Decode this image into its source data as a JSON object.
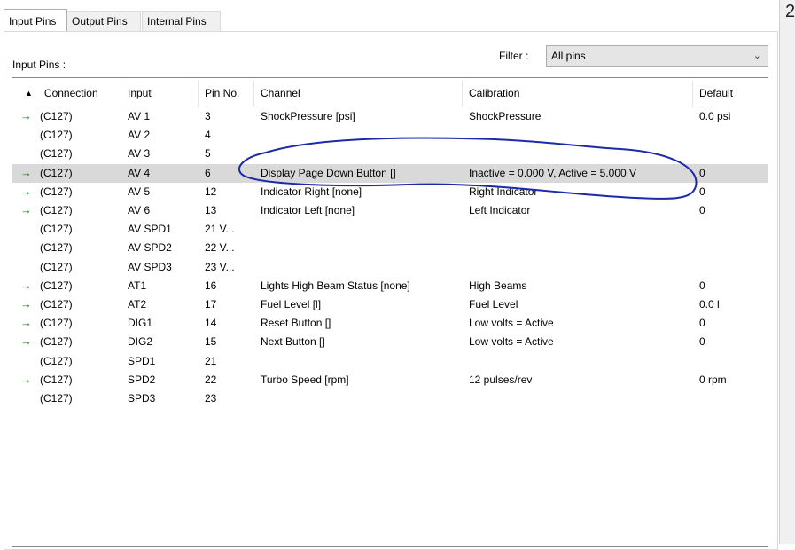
{
  "tabs": [
    {
      "label": "Input Pins",
      "active": true
    },
    {
      "label": "Output Pins",
      "active": false
    },
    {
      "label": "Internal Pins",
      "active": false
    }
  ],
  "panel": {
    "section_label": "Input Pins :",
    "filter_label": "Filter :",
    "filter_value": "All pins"
  },
  "table": {
    "columns": [
      "Connection",
      "Input",
      "Pin No.",
      "Channel",
      "Calibration",
      "Default"
    ],
    "rows": [
      {
        "arrow": true,
        "connection": "(C127)",
        "input": "AV 1",
        "pin": "3",
        "channel": "ShockPressure [psi]",
        "calibration": "ShockPressure",
        "default": "0.0 psi"
      },
      {
        "arrow": false,
        "connection": "(C127)",
        "input": "AV 2",
        "pin": "4",
        "channel": "",
        "calibration": "",
        "default": ""
      },
      {
        "arrow": false,
        "connection": "(C127)",
        "input": "AV 3",
        "pin": "5",
        "channel": "",
        "calibration": "",
        "default": ""
      },
      {
        "arrow": true,
        "connection": "(C127)",
        "input": "AV 4",
        "pin": "6",
        "channel": "Display Page Down Button []",
        "calibration": "Inactive = 0.000 V, Active = 5.000 V",
        "default": "0",
        "selected": true
      },
      {
        "arrow": true,
        "connection": "(C127)",
        "input": "AV 5",
        "pin": "12",
        "channel": "Indicator Right [none]",
        "calibration": "Right Indicator",
        "default": "0"
      },
      {
        "arrow": true,
        "connection": "(C127)",
        "input": "AV 6",
        "pin": "13",
        "channel": "Indicator Left [none]",
        "calibration": "Left Indicator",
        "default": "0"
      },
      {
        "arrow": false,
        "connection": "(C127)",
        "input": "AV SPD1",
        "pin": "21 V...",
        "channel": "",
        "calibration": "",
        "default": ""
      },
      {
        "arrow": false,
        "connection": "(C127)",
        "input": "AV SPD2",
        "pin": "22 V...",
        "channel": "",
        "calibration": "",
        "default": ""
      },
      {
        "arrow": false,
        "connection": "(C127)",
        "input": "AV SPD3",
        "pin": "23 V...",
        "channel": "",
        "calibration": "",
        "default": ""
      },
      {
        "arrow": true,
        "connection": "(C127)",
        "input": "AT1",
        "pin": "16",
        "channel": "Lights High Beam Status [none]",
        "calibration": "High Beams",
        "default": "0"
      },
      {
        "arrow": true,
        "connection": "(C127)",
        "input": "AT2",
        "pin": "17",
        "channel": "Fuel Level [l]",
        "calibration": "Fuel Level",
        "default": "0.0 l"
      },
      {
        "arrow": true,
        "connection": "(C127)",
        "input": "DIG1",
        "pin": "14",
        "channel": "Reset Button []",
        "calibration": "Low volts = Active",
        "default": "0"
      },
      {
        "arrow": true,
        "connection": "(C127)",
        "input": "DIG2",
        "pin": "15",
        "channel": "Next Button []",
        "calibration": "Low volts = Active",
        "default": "0"
      },
      {
        "arrow": false,
        "connection": "(C127)",
        "input": "SPD1",
        "pin": "21",
        "channel": "",
        "calibration": "",
        "default": ""
      },
      {
        "arrow": true,
        "connection": "(C127)",
        "input": "SPD2",
        "pin": "22",
        "channel": "Turbo Speed [rpm]",
        "calibration": "12 pulses/rev",
        "default": "0 rpm"
      },
      {
        "arrow": false,
        "connection": "(C127)",
        "input": "SPD3",
        "pin": "23",
        "channel": "",
        "calibration": "",
        "default": ""
      }
    ]
  },
  "edge_glyph": "2",
  "icons": {
    "arrow": "right-arrow-icon",
    "sort": "sort-ascending-icon",
    "dropdown": "chevron-down-icon"
  },
  "colors": {
    "arrow": "#1a8a1a",
    "selected_row": "#d9d9d9",
    "annotation": "#1a2aa8"
  }
}
